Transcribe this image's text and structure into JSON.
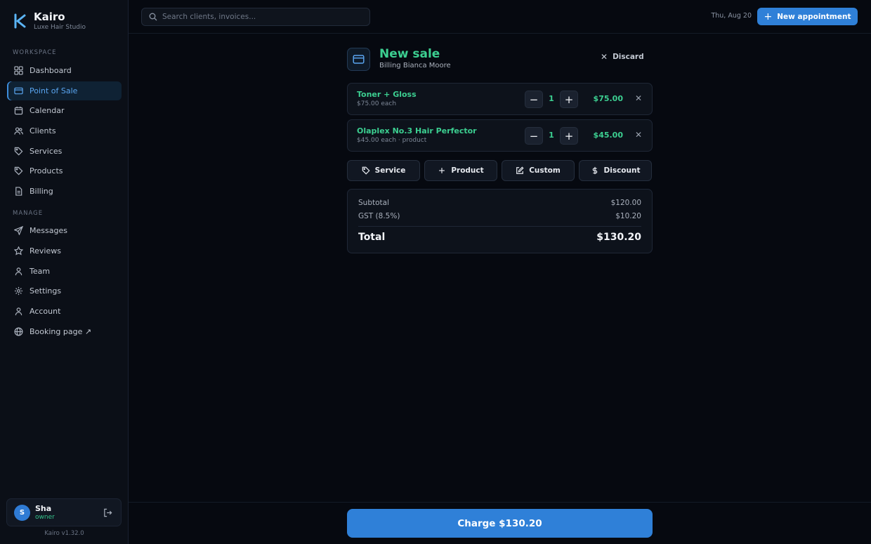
{
  "brand": {
    "name": "Kairo",
    "subtitle": "Luxe Hair Studio",
    "accent": "#3d8ddc"
  },
  "sidebar": {
    "workspace_label": "WORKSPACE",
    "manage_label": "MANAGE",
    "workspace_items": [
      {
        "label": "Dashboard",
        "icon": "grid-icon"
      },
      {
        "label": "Point of Sale",
        "icon": "credit-card-icon",
        "active": true
      },
      {
        "label": "Calendar",
        "icon": "calendar-icon"
      },
      {
        "label": "Clients",
        "icon": "users-icon"
      },
      {
        "label": "Services",
        "icon": "tag-icon"
      },
      {
        "label": "Products",
        "icon": "tag-icon"
      },
      {
        "label": "Billing",
        "icon": "file-icon"
      }
    ],
    "manage_items": [
      {
        "label": "Messages",
        "icon": "send-icon"
      },
      {
        "label": "Reviews",
        "icon": "star-icon"
      },
      {
        "label": "Team",
        "icon": "user-icon"
      },
      {
        "label": "Settings",
        "icon": "gear-icon"
      },
      {
        "label": "Account",
        "icon": "user-icon"
      },
      {
        "label": "Booking page ↗",
        "icon": "globe-icon"
      }
    ],
    "user": {
      "initial": "S",
      "name": "Sha",
      "role": "owner"
    },
    "version": "Kairo v1.32.0"
  },
  "topbar": {
    "search_placeholder": "Search clients, invoices...",
    "date": "Thu, Aug 20",
    "new_appointment": "New appointment"
  },
  "sale": {
    "title": "New sale",
    "subtitle": "Billing Bianca Moore",
    "discard": "Discard",
    "items": [
      {
        "name": "Toner + Gloss",
        "desc": "$75.00 each",
        "qty": "1",
        "price": "$75.00"
      },
      {
        "name": "Olaplex No.3 Hair Perfector",
        "desc": "$45.00 each · product",
        "qty": "1",
        "price": "$45.00"
      }
    ],
    "add_buttons": [
      {
        "label": "Service",
        "icon": "tag-icon"
      },
      {
        "label": "Product",
        "icon": "plus-icon"
      },
      {
        "label": "Custom",
        "icon": "edit-icon"
      },
      {
        "label": "Discount",
        "icon": "dollar-icon"
      }
    ],
    "totals": {
      "subtotal_label": "Subtotal",
      "subtotal": "$120.00",
      "tax_label": "GST (8.5%)",
      "tax": "$10.20",
      "total_label": "Total",
      "total": "$130.20"
    },
    "charge": "Charge $130.20"
  },
  "colors": {
    "primary": "#2f80d8",
    "success": "#3ccf91",
    "background": "#060910"
  }
}
